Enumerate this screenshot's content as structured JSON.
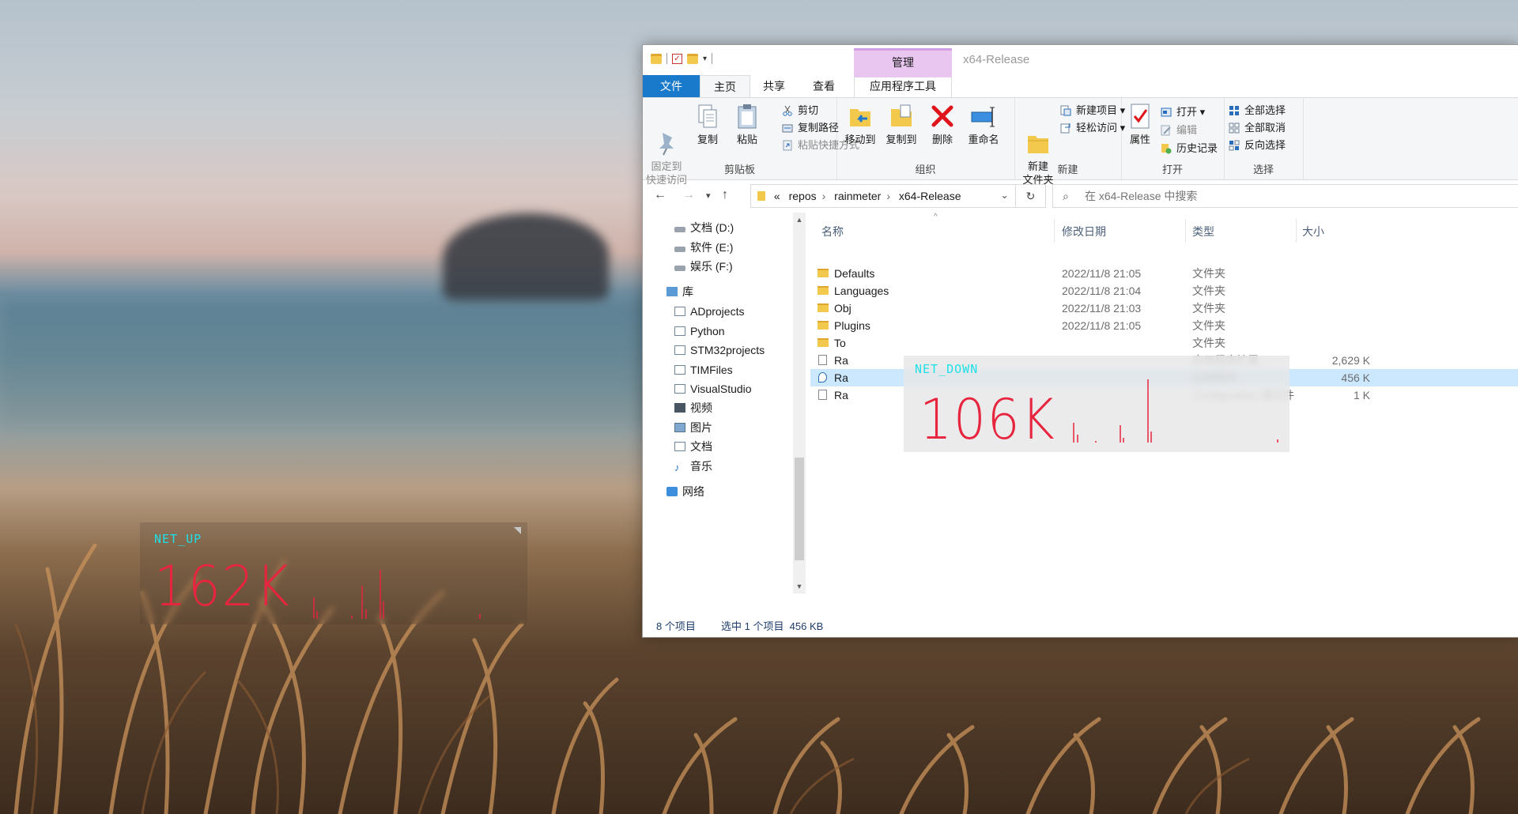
{
  "desktop": {
    "net_up": {
      "label": "NET_UP",
      "value": "162K"
    },
    "net_down": {
      "label": "NET_DOWN",
      "value": "106K"
    }
  },
  "window": {
    "title": "x64-Release",
    "context_tab_group": "管理",
    "tabs": [
      "文件",
      "主页",
      "共享",
      "查看",
      "应用程序工具"
    ],
    "ribbon": {
      "clipboard": {
        "group_label": "剪贴板",
        "pin": "固定到\n快速访问",
        "copy": "复制",
        "paste": "粘贴",
        "cut": "剪切",
        "copy_path": "复制路径",
        "paste_shortcut": "粘贴快捷方式"
      },
      "organize": {
        "group_label": "组织",
        "move_to": "移动到",
        "copy_to": "复制到",
        "delete": "删除",
        "rename": "重命名"
      },
      "new": {
        "group_label": "新建",
        "new_folder": "新建\n文件夹",
        "new_item": "新建项目",
        "easy_access": "轻松访问"
      },
      "open": {
        "group_label": "打开",
        "properties": "属性",
        "open": "打开",
        "edit": "编辑",
        "history": "历史记录"
      },
      "select": {
        "group_label": "选择",
        "select_all": "全部选择",
        "select_none": "全部取消",
        "invert": "反向选择"
      }
    },
    "address": {
      "crumbs": [
        "«",
        "repos",
        "rainmeter",
        "x64-Release"
      ],
      "search_placeholder": "在 x64-Release 中搜索"
    },
    "nav_pane": {
      "drives": [
        "文档 (D:)",
        "软件 (E:)",
        "娱乐 (F:)"
      ],
      "library_label": "库",
      "libraries": [
        "ADprojects",
        "Python",
        "STM32projects",
        "TIMFiles",
        "VisualStudio",
        "视频",
        "图片",
        "文档",
        "音乐"
      ],
      "network": "网络"
    },
    "columns": {
      "name": "名称",
      "modified": "修改日期",
      "type": "类型",
      "size": "大小"
    },
    "files": [
      {
        "name": "Defaults",
        "date": "2022/11/8 21:05",
        "type": "文件夹",
        "size": ""
      },
      {
        "name": "Languages",
        "date": "2022/11/8 21:04",
        "type": "文件夹",
        "size": ""
      },
      {
        "name": "Obj",
        "date": "2022/11/8 21:03",
        "type": "文件夹",
        "size": ""
      },
      {
        "name": "Plugins",
        "date": "2022/11/8 21:05",
        "type": "文件夹",
        "size": ""
      },
      {
        "name": "To",
        "date": "",
        "type": "文件夹",
        "size": ""
      },
      {
        "name": "Ra",
        "date": "",
        "type": "应用程序扩展",
        "size": "2,629 K"
      },
      {
        "name": "Ra",
        "date": "",
        "type": "应用程序",
        "size": "456 K"
      },
      {
        "name": "Ra",
        "date": "",
        "type": "Configuration 源文件",
        "size": "1 K"
      }
    ],
    "status": {
      "count": "8 个项目",
      "selected": "选中 1 个项目  456 KB"
    }
  },
  "colors": {
    "accent": "#1979ca",
    "selection": "#cce8ff",
    "widget_label": "#1de0e8",
    "widget_value": "#e8253f"
  }
}
